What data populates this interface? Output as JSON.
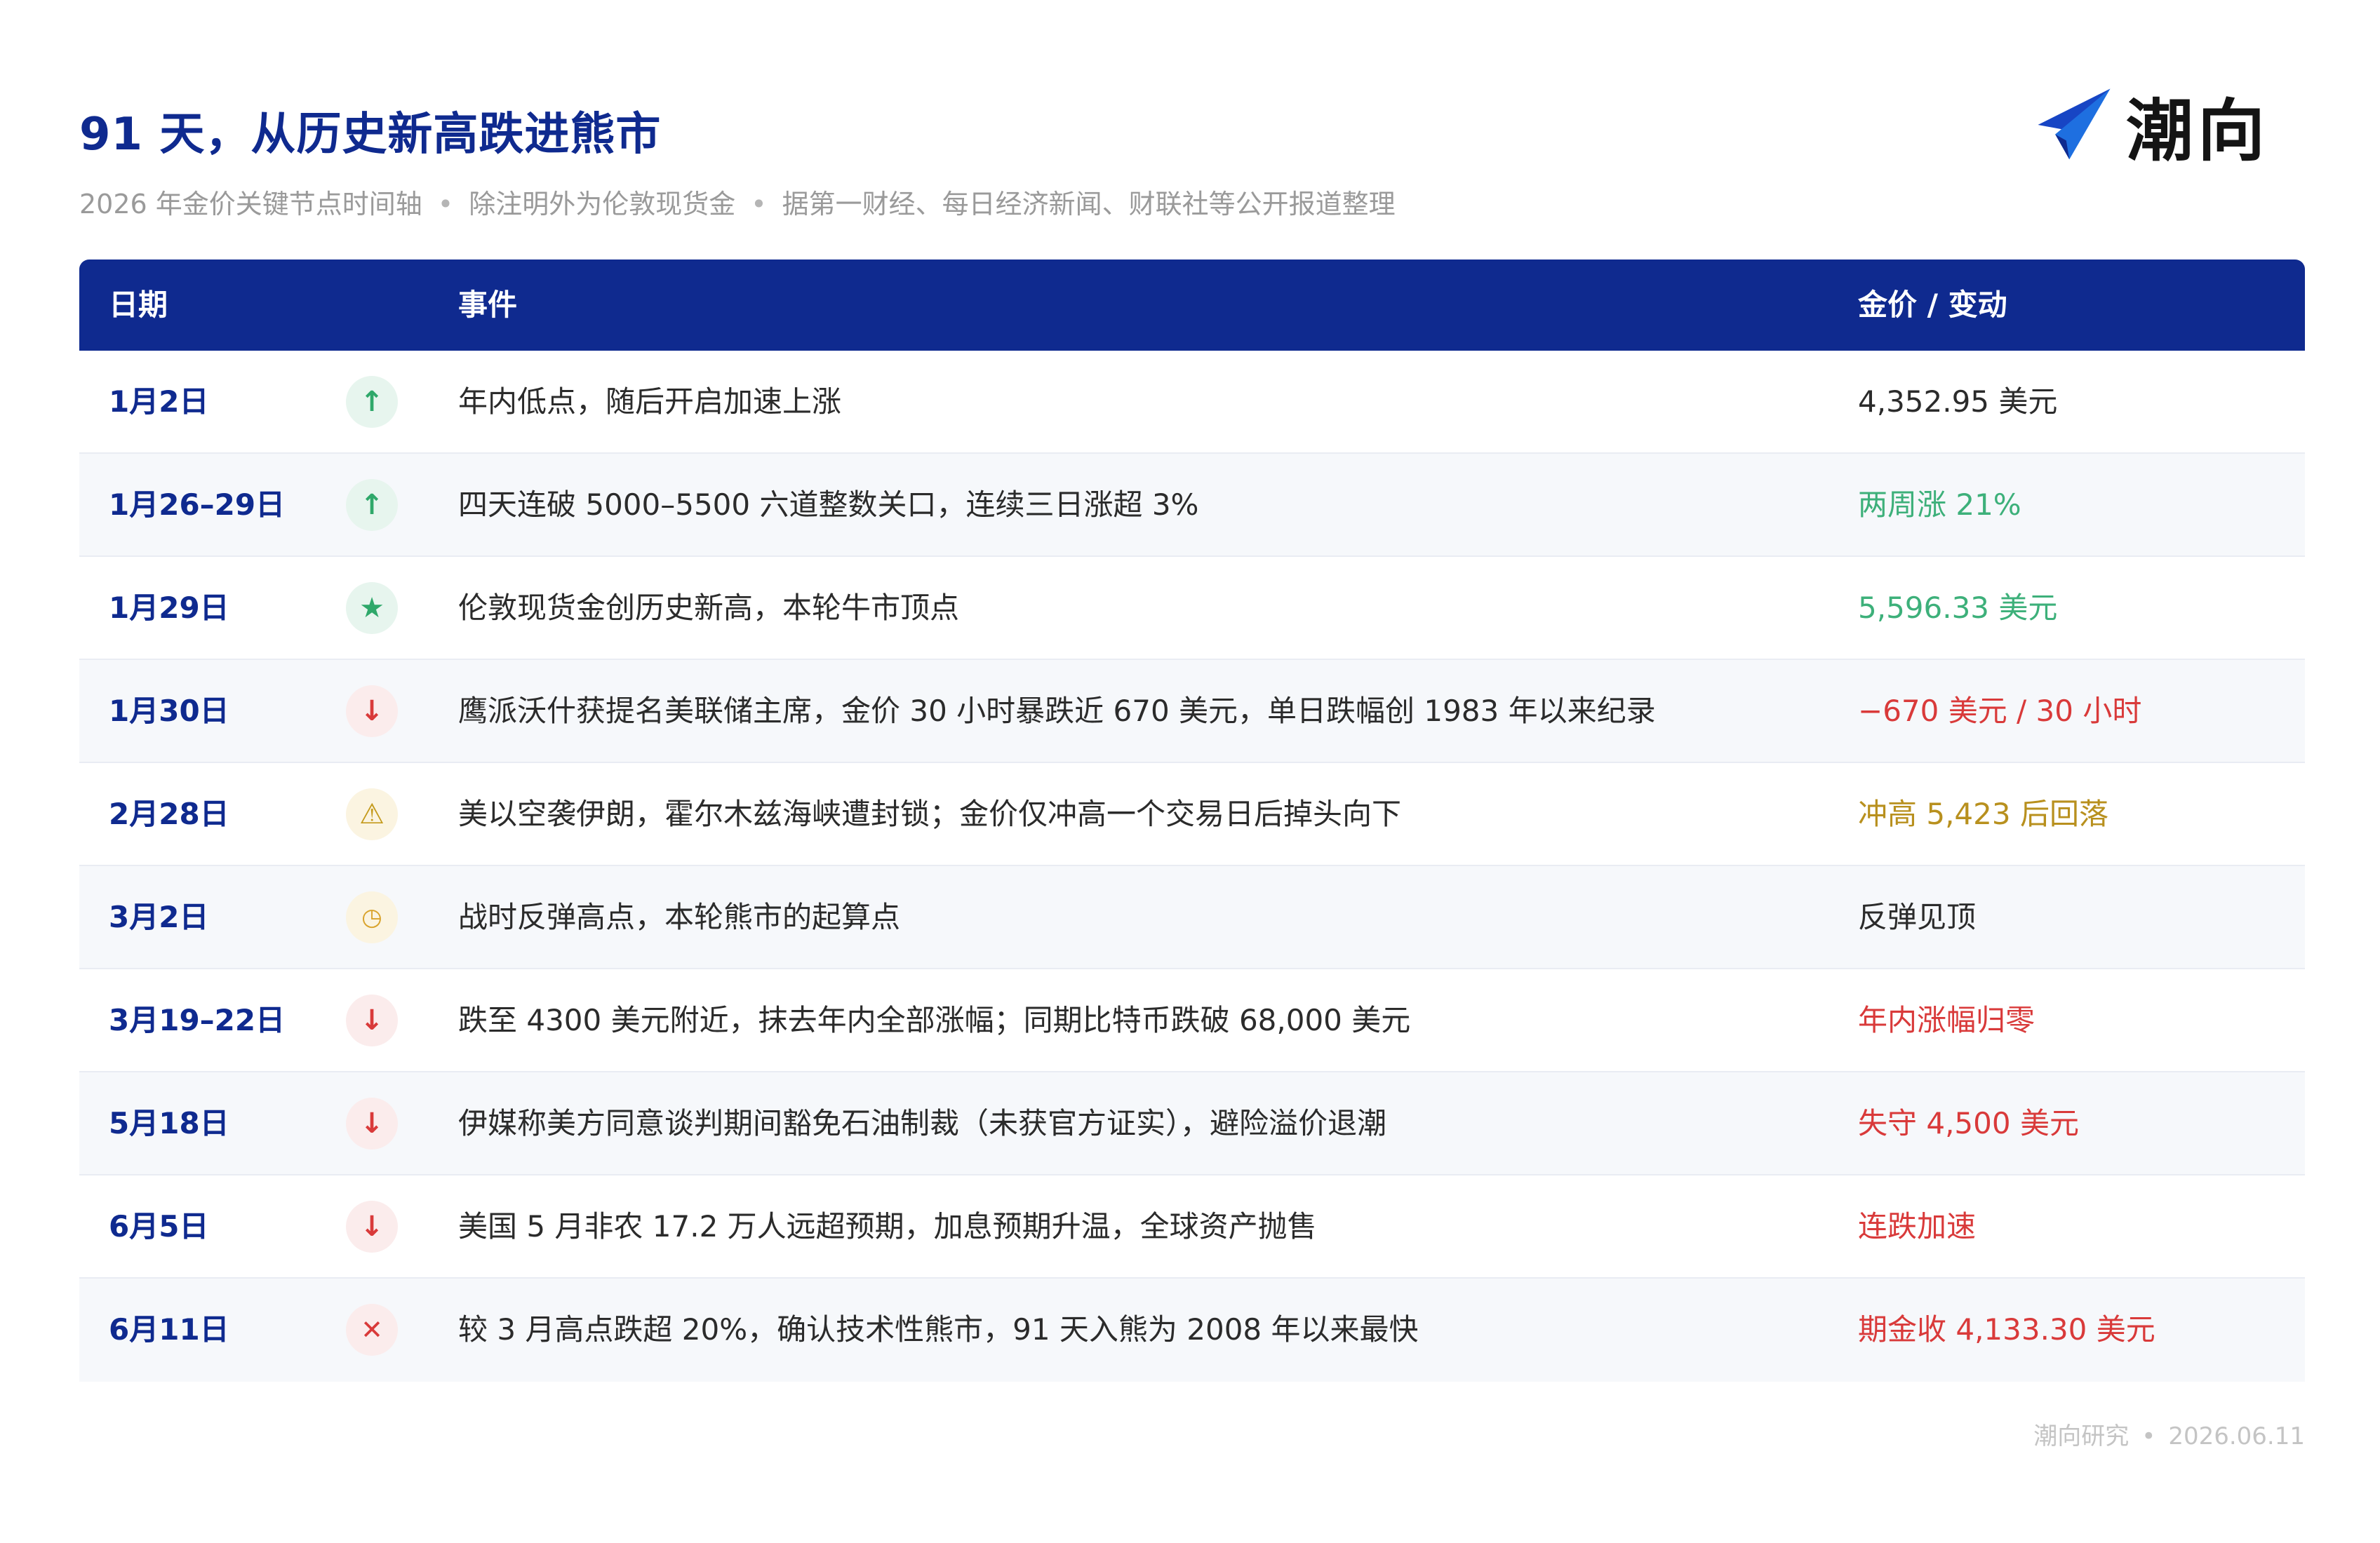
{
  "header": {
    "title": "91 天，从历史新高跌进熊市",
    "subtitle_parts": [
      "2026 年金价关键节点时间轴",
      "除注明外为伦敦现货金",
      "据第一财经、每日经济新闻、财联社等公开报道整理"
    ],
    "separator": "•"
  },
  "logo": {
    "text": "潮向",
    "icon": "paper-plane-arrow-icon",
    "colors": [
      "#1e6fe0",
      "#1745c4"
    ]
  },
  "table": {
    "headers": {
      "date": "日期",
      "event": "事件",
      "price": "金价 / 变动"
    },
    "header_bg": "#0f2a8f",
    "rows": [
      {
        "date": "1月2日",
        "icon": "arrow-up-icon",
        "glyph": "↑",
        "kind": "up",
        "event": "年内低点，随后开启加速上涨",
        "price": "4,352.95 美元",
        "price_color": "#2b2b2b"
      },
      {
        "date": "1月26–29日",
        "icon": "arrow-up-icon",
        "glyph": "↑",
        "kind": "up",
        "event": "四天连破 5000–5500 六道整数关口，连续三日涨超 3%",
        "price": "两周涨 21%",
        "price_color": "#3db07a"
      },
      {
        "date": "1月29日",
        "icon": "star-icon",
        "glyph": "★",
        "kind": "star",
        "event": "伦敦现货金创历史新高，本轮牛市顶点",
        "price": "5,596.33 美元",
        "price_color": "#3db07a"
      },
      {
        "date": "1月30日",
        "icon": "arrow-down-icon",
        "glyph": "↓",
        "kind": "down",
        "event": "鹰派沃什获提名美联储主席，金价 30 小时暴跌近 670 美元，单日跌幅创 1983 年以来纪录",
        "price": "−670 美元 / 30 小时",
        "price_color": "#d93a3a"
      },
      {
        "date": "2月28日",
        "icon": "warning-icon",
        "glyph": "⚠",
        "kind": "warn",
        "event": "美以空袭伊朗，霍尔木兹海峡遭封锁；金价仅冲高一个交易日后掉头向下",
        "price": "冲高 5,423 后回落",
        "price_color": "#b8901e"
      },
      {
        "date": "3月2日",
        "icon": "clock-icon",
        "glyph": "◷",
        "kind": "clock",
        "event": "战时反弹高点，本轮熊市的起算点",
        "price": "反弹见顶",
        "price_color": "#2b2b2b"
      },
      {
        "date": "3月19–22日",
        "icon": "arrow-down-icon",
        "glyph": "↓",
        "kind": "down",
        "event": "跌至 4300 美元附近，抹去年内全部涨幅；同期比特币跌破 68,000 美元",
        "price": "年内涨幅归零",
        "price_color": "#d93a3a"
      },
      {
        "date": "5月18日",
        "icon": "arrow-down-icon",
        "glyph": "↓",
        "kind": "down",
        "event": "伊媒称美方同意谈判期间豁免石油制裁（未获官方证实），避险溢价退潮",
        "price": "失守 4,500 美元",
        "price_color": "#d93a3a"
      },
      {
        "date": "6月5日",
        "icon": "arrow-down-icon",
        "glyph": "↓",
        "kind": "down",
        "event": "美国 5 月非农 17.2 万人远超预期，加息预期升温，全球资产抛售",
        "price": "连跌加速",
        "price_color": "#d93a3a"
      },
      {
        "date": "6月11日",
        "icon": "close-icon",
        "glyph": "✕",
        "kind": "x",
        "event": "较 3 月高点跌超 20%，确认技术性熊市，91 天入熊为 2008 年以来最快",
        "price": "期金收 4,133.30 美元",
        "price_color": "#d93a3a"
      }
    ]
  },
  "footer": {
    "source": "潮向研究",
    "separator": "•",
    "date": "2026.06.11"
  }
}
